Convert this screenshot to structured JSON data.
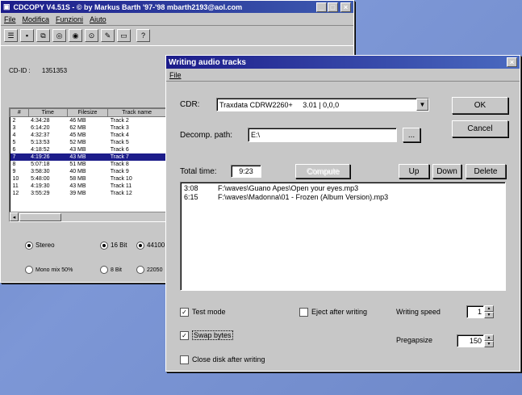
{
  "main_window": {
    "title": "CDCOPY V4.51S - © by Markus Barth '97-'98 mbarth2193@aol.com",
    "menu": [
      "File",
      "Modifica",
      "Funzioni",
      "Aiuto"
    ],
    "cd_id_label": "CD-ID :",
    "cd_id_value": "1351353",
    "table_headers": [
      "#",
      "Time",
      "Filesize",
      "Track name"
    ],
    "tracks": [
      [
        "2",
        "4:34:28",
        "46 MB",
        "Track 2"
      ],
      [
        "3",
        "6:14:20",
        "62 MB",
        "Track 3"
      ],
      [
        "4",
        "4:32:37",
        "45 MB",
        "Track 4"
      ],
      [
        "5",
        "5:13:53",
        "52 MB",
        "Track 5"
      ],
      [
        "6",
        "4:18:52",
        "43 MB",
        "Track 6"
      ],
      [
        "7",
        "4:19:26",
        "43 MB",
        "Track 7"
      ],
      [
        "8",
        "5:07:18",
        "51 MB",
        "Track 8"
      ],
      [
        "9",
        "3:58:30",
        "40 MB",
        "Track 9"
      ],
      [
        "10",
        "5:48:00",
        "58 MB",
        "Track 10"
      ],
      [
        "11",
        "4:19:30",
        "43 MB",
        "Track 11"
      ],
      [
        "12",
        "3:55:29",
        "39 MB",
        "Track 12"
      ]
    ],
    "selected_track": "7",
    "stereo_label": "Stereo",
    "mono_label": "Mono mix 50%",
    "bits16_label": "16 Bit",
    "bits8_label": "8 Bit",
    "rate44_label": "44100",
    "rate22_label": "22050"
  },
  "dialog": {
    "title": "Writing audio tracks",
    "menu": [
      "File"
    ],
    "cdr_label": "CDR:",
    "cdr_value": "Traxdata CDRW2260+     3.01 | 0,0,0",
    "decomp_label": "Decomp. path:",
    "decomp_value": "E:\\",
    "browse_label": "...",
    "total_time_label": "Total time:",
    "total_time_value": "9:23",
    "disabled_button_label": "Compute",
    "ok_label": "OK",
    "cancel_label": "Cancel",
    "up_label": "Up",
    "down_label": "Down",
    "delete_label": "Delete",
    "files": [
      {
        "time": "3:08",
        "path": "F:\\waves\\Guano Apes\\Open your eyes.mp3"
      },
      {
        "time": "6:15",
        "path": "F:\\waves\\Madonna\\01 - Frozen (Album Version).mp3"
      }
    ],
    "test_mode_label": "Test mode",
    "swap_bytes_label": "Swap bytes",
    "close_disk_label": "Close disk after writing",
    "eject_label": "Eject after writing",
    "writing_speed_label": "Writing speed",
    "writing_speed_value": "1",
    "pregapsize_label": "Pregapsize",
    "pregapsize_value": "150"
  },
  "colors": {
    "desktop": "#7088c8",
    "titlebar_active": "#1c1c8a",
    "window_face": "#c7c7c7"
  }
}
